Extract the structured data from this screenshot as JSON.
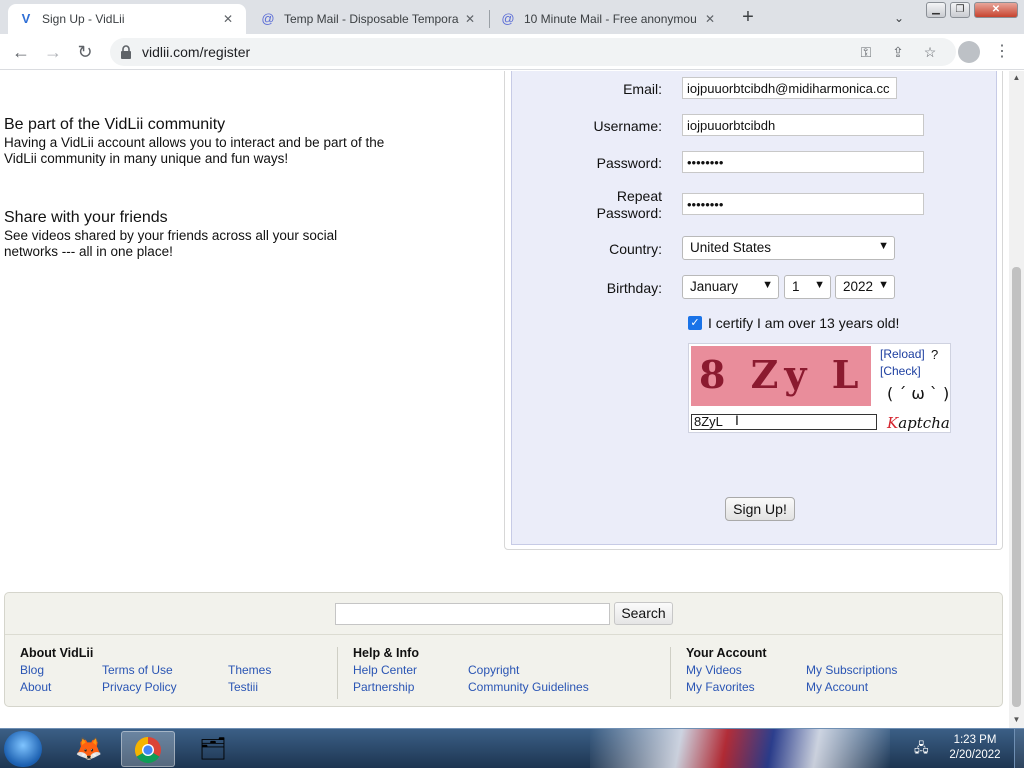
{
  "browser": {
    "tabs": [
      {
        "title": "Sign Up - VidLii",
        "icon": "vidlii-favicon"
      },
      {
        "title": "Temp Mail - Disposable Tempora",
        "icon": "at-sign-icon"
      },
      {
        "title": "10 Minute Mail - Free anonymou",
        "icon": "at-sign-icon"
      }
    ],
    "new_tab": "+",
    "url": "vidlii.com/register"
  },
  "promo": [
    {
      "heading": "Be part of the VidLii community",
      "text": "Having a VidLii account allows you to interact and be part of the VidLii community in many unique and fun ways!"
    },
    {
      "heading": "Share with your friends",
      "text": "See videos shared by your friends across all your social networks --- all in one place!"
    }
  ],
  "form": {
    "email_label": "Email:",
    "email_value": "iojpuuorbtcibdh@midiharmonica.cc",
    "username_label": "Username:",
    "username_value": "iojpuuorbtcibdh",
    "password_label": "Password:",
    "password_value": "••••••••",
    "repeat_password_label": "Repeat Password:",
    "repeat_password_value": "••••••••",
    "country_label": "Country:",
    "country_value": "United States",
    "birthday_label": "Birthday:",
    "birthday_month": "January",
    "birthday_day": "1",
    "birthday_year": "2022",
    "certify_checked": true,
    "certify_label": "I certify I am over 13 years old!",
    "captcha_text": "8 Zy L",
    "captcha_reload": "[Reload]",
    "captcha_check": "[Check]",
    "captcha_help": "?",
    "captcha_face": "( ´ ω ` )",
    "captcha_input": "8ZyL",
    "captcha_brand_k": "K",
    "captcha_brand_rest": "aptcha",
    "signup_label": "Sign Up!"
  },
  "footer": {
    "search_button": "Search",
    "columns": [
      {
        "heading": "About VidLii",
        "links": [
          "Blog",
          "Terms of Use",
          "Themes",
          "About",
          "Privacy Policy",
          "Testiii"
        ]
      },
      {
        "heading": "Help & Info",
        "links": [
          "Help Center",
          "Copyright",
          "Partnership",
          "Community Guidelines"
        ]
      },
      {
        "heading": "Your Account",
        "links": [
          "My Videos",
          "My Subscriptions",
          "My Favorites",
          "My Account"
        ]
      }
    ]
  },
  "taskbar": {
    "time": "1:23 PM",
    "date": "2/20/2022"
  },
  "colors": {
    "form_bg": "#ebedf9",
    "link": "#2a55b4",
    "checkbox": "#1a73e8",
    "captcha_bg": "#e98d9b"
  }
}
